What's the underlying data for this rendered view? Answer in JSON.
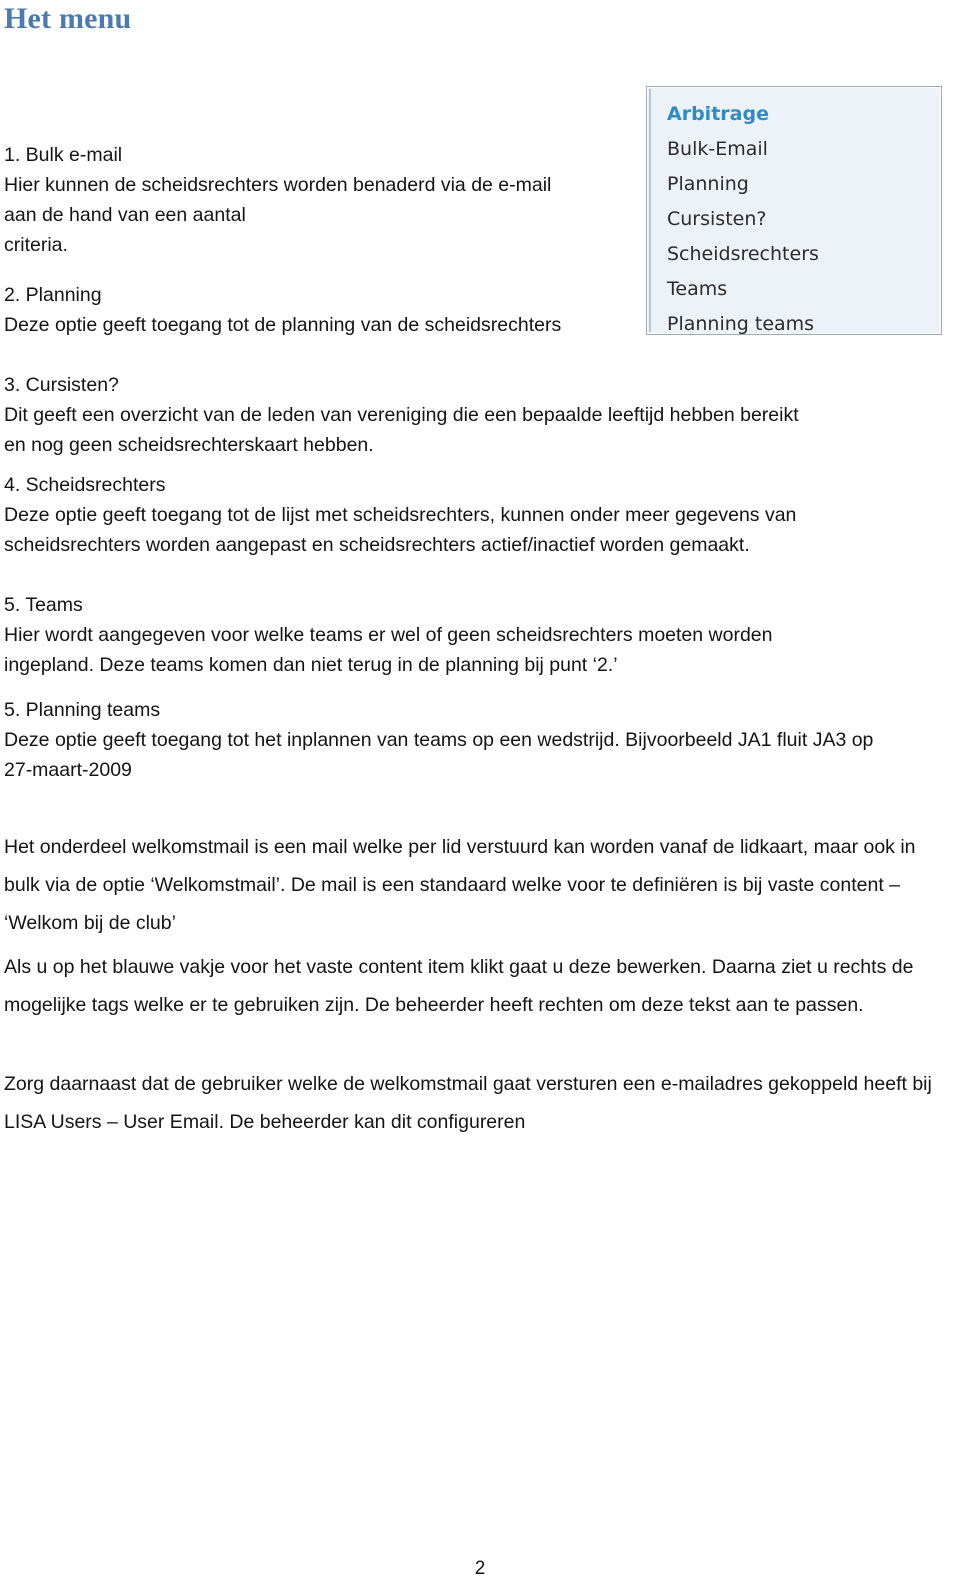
{
  "document": {
    "title": "Het menu",
    "title_color": "#4a7ab0",
    "page_number": "2"
  },
  "menu_screenshot": {
    "name": "arbitrage-menu",
    "background": "#edf2f7",
    "border_color": "#9aaabb",
    "header_color": "#2e8bc6",
    "items": [
      {
        "label": "Arbitrage",
        "is_header": true
      },
      {
        "label": "Bulk-Email",
        "is_header": false
      },
      {
        "label": "Planning",
        "is_header": false
      },
      {
        "label": "Cursisten?",
        "is_header": false
      },
      {
        "label": "Scheidsrechters",
        "is_header": false
      },
      {
        "label": "Teams",
        "is_header": false
      },
      {
        "label": "Planning teams",
        "is_header": false
      }
    ]
  },
  "sections": [
    {
      "id": "bulk-email",
      "heading": "1. Bulk e-mail",
      "lines": [
        "Hier kunnen de scheidsrechters worden benaderd via de e-mail",
        "aan de hand van een aantal",
        "criteria."
      ]
    },
    {
      "id": "planning",
      "heading": "2. Planning",
      "lines": [
        "Deze optie geeft toegang tot de planning van de scheidsrechters"
      ]
    },
    {
      "id": "cursisten",
      "heading": "3. Cursisten?",
      "lines": [
        "Dit geeft een overzicht van de leden van vereniging die een bepaalde leeftijd hebben bereikt",
        "en nog geen scheidsrechterskaart hebben."
      ]
    },
    {
      "id": "scheidsrechters",
      "heading": "4. Scheidsrechters",
      "lines": [
        "Deze optie geeft toegang tot de lijst met scheidsrechters, kunnen onder meer gegevens van",
        "scheidsrechters worden aangepast en scheidsrechters actief/inactief worden gemaakt."
      ]
    },
    {
      "id": "teams",
      "heading": "5. Teams",
      "lines": [
        "Hier wordt aangegeven voor welke teams er wel of geen scheidsrechters moeten worden",
        "ingepland. Deze teams komen dan niet terug in de planning bij punt ‘2.’"
      ]
    },
    {
      "id": "planning-teams",
      "heading": "5. Planning teams",
      "lines": [
        "Deze optie geeft toegang tot het inplannen van teams op een wedstrijd. Bijvoorbeeld JA1 fluit JA3 op",
        "27-maart-2009"
      ]
    }
  ],
  "paragraphs": [
    {
      "id": "welkomstmail-intro",
      "text": "Het onderdeel welkomstmail is een mail welke per lid verstuurd kan worden vanaf de lidkaart, maar ook in bulk via de optie ‘Welkomstmail’. De mail is een standaard welke voor te definiëren is bij vaste content – ‘Welkom bij de club’"
    },
    {
      "id": "blauwe-vakje",
      "text": "Als u op het blauwe vakje voor het vaste content item klikt gaat u deze bewerken. Daarna ziet u rechts de mogelijke tags welke er te gebruiken zijn. De beheerder heeft rechten om deze tekst aan te passen."
    },
    {
      "id": "lisa-users",
      "text": "Zorg daarnaast dat de gebruiker welke de welkomstmail gaat versturen een e-mailadres gekoppeld heeft bij LISA Users – User Email. De beheerder kan dit configureren"
    }
  ]
}
